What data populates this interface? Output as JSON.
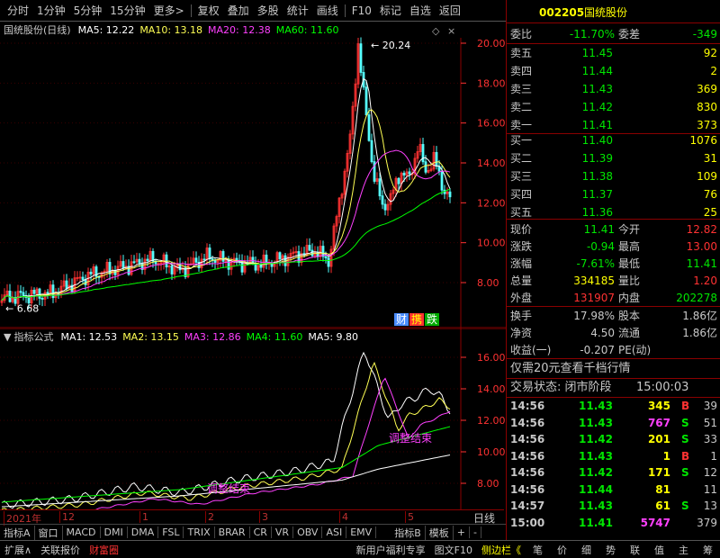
{
  "toolbar": {
    "items": [
      "分时",
      "1分钟",
      "5分钟",
      "15分钟",
      "更多>",
      "复权",
      "叠加",
      "多股",
      "统计",
      "画线",
      "F10",
      "标记",
      "自选",
      "返回"
    ]
  },
  "stock": {
    "code": "002205",
    "name": "国统股份"
  },
  "chart_header": {
    "title": "国统股份(日线)",
    "ma5": "MA5: 12.22",
    "ma10": "MA10: 13.18",
    "ma20": "MA20: 12.38",
    "ma60": "MA60: 11.60"
  },
  "price_axis": [
    "20.00",
    "18.00",
    "16.00",
    "14.00",
    "12.00",
    "10.00",
    "8.00"
  ],
  "price_marks": {
    "high": "20.24",
    "low": "6.68"
  },
  "tags": {
    "cai": "财",
    "ju": "携",
    "die": "跌"
  },
  "indicator_header": {
    "title": "指标公式",
    "ma1": "MA1: 12.53",
    "ma2": "MA2: 13.15",
    "ma3": "MA3: 12.86",
    "ma4": "MA4: 11.60",
    "ma5": "MA5: 9.80"
  },
  "indicator_axis": [
    "16.00",
    "14.00",
    "12.00",
    "10.00",
    "8.00"
  ],
  "indicator_notes": {
    "adjust_end": "调整结束",
    "adjust_start": "调整结束"
  },
  "x_axis": [
    "2021年",
    "12",
    "1",
    "2",
    "3",
    "4",
    "5"
  ],
  "x_axis_right": "日线",
  "bottom_tabs": [
    "指标A",
    "窗口",
    "MACD",
    "DMI",
    "DMA",
    "FSL",
    "TRIX",
    "BRAR",
    "CR",
    "VR",
    "OBV",
    "ASI",
    "EMV",
    "指标B",
    "模板",
    "+",
    "-"
  ],
  "status_bar": {
    "left": [
      "扩展∧",
      "关联报价",
      "财富圈"
    ],
    "middle": [
      "新用户福利专享",
      "图文F10",
      "侧边栏《"
    ],
    "right": [
      "笔",
      "价",
      "细",
      "势",
      "联",
      "值",
      "主",
      "筹"
    ]
  },
  "quote": {
    "weibi_label": "委比",
    "weibi": "-11.70%",
    "weicha_label": "委差",
    "weicha": "-349",
    "asks": [
      {
        "label": "卖五",
        "price": "11.45",
        "vol": "92"
      },
      {
        "label": "卖四",
        "price": "11.44",
        "vol": "2"
      },
      {
        "label": "卖三",
        "price": "11.43",
        "vol": "369"
      },
      {
        "label": "卖二",
        "price": "11.42",
        "vol": "830"
      },
      {
        "label": "卖一",
        "price": "11.41",
        "vol": "373"
      }
    ],
    "bids": [
      {
        "label": "买一",
        "price": "11.40",
        "vol": "1076"
      },
      {
        "label": "买二",
        "price": "11.39",
        "vol": "31"
      },
      {
        "label": "买三",
        "price": "11.38",
        "vol": "109"
      },
      {
        "label": "买四",
        "price": "11.37",
        "vol": "76"
      },
      {
        "label": "买五",
        "price": "11.36",
        "vol": "25"
      }
    ],
    "stats": [
      {
        "l1": "现价",
        "v1": "11.41",
        "l2": "今开",
        "v2": "12.82"
      },
      {
        "l1": "涨跌",
        "v1": "-0.94",
        "l2": "最高",
        "v2": "13.00"
      },
      {
        "l1": "涨幅",
        "v1": "-7.61%",
        "l2": "最低",
        "v2": "11.41"
      },
      {
        "l1": "总量",
        "v1": "334185",
        "l2": "量比",
        "v2": "1.20"
      },
      {
        "l1": "外盘",
        "v1": "131907",
        "l2": "内盘",
        "v2": "202278"
      }
    ],
    "stats2": [
      {
        "l1": "换手",
        "v1": "17.98%",
        "l2": "股本",
        "v2": "1.86亿"
      },
      {
        "l1": "净资",
        "v1": "4.50",
        "l2": "流通",
        "v2": "1.86亿"
      },
      {
        "l1": "收益(一)",
        "v1": "-0.207",
        "l2": "PE(动)",
        "v2": ""
      }
    ],
    "promo": "仅需20元查看千档行情",
    "trade_status_label": "交易状态: 闭市阶段",
    "trade_status_time": "15:00:03",
    "ticks": [
      {
        "t": "14:56",
        "p": "11.43",
        "v": "345",
        "d": "B",
        "n": "39"
      },
      {
        "t": "14:56",
        "p": "11.43",
        "v": "767",
        "d": "S",
        "n": "51"
      },
      {
        "t": "14:56",
        "p": "11.42",
        "v": "201",
        "d": "S",
        "n": "33"
      },
      {
        "t": "14:56",
        "p": "11.43",
        "v": "1",
        "d": "B",
        "n": "1"
      },
      {
        "t": "14:56",
        "p": "11.42",
        "v": "171",
        "d": "S",
        "n": "12"
      },
      {
        "t": "14:56",
        "p": "11.44",
        "v": "81",
        "d": "",
        "n": "11"
      },
      {
        "t": "14:57",
        "p": "11.43",
        "v": "61",
        "d": "S",
        "n": "13"
      },
      {
        "t": "15:00",
        "p": "11.41",
        "v": "5747",
        "d": "",
        "n": "379"
      }
    ]
  },
  "colors": {
    "up": "#ff3232",
    "down": "#00e600",
    "yellow": "#ffff00",
    "ma_white": "#ffffff",
    "ma_yellow": "#ffff54",
    "ma_magenta": "#ff40ff",
    "ma_green": "#00ff00",
    "border": "#8a0000",
    "blue": "#4a8cff"
  }
}
